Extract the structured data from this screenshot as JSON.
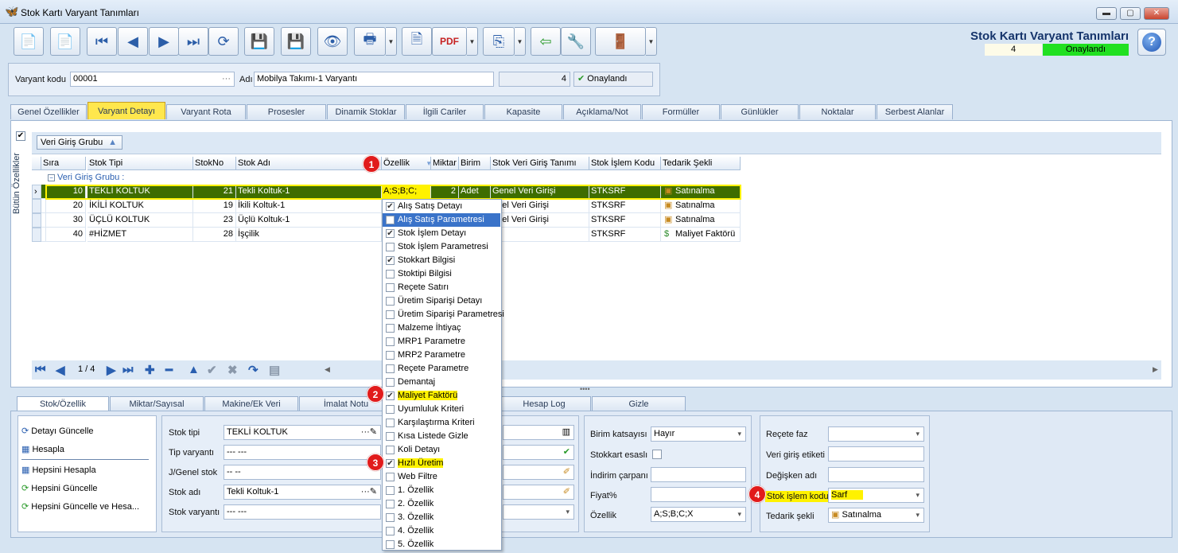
{
  "window": {
    "title": "Stok Kartı Varyant Tanımları"
  },
  "header": {
    "title": "Stok Kartı Varyant Tanımları",
    "count": "4",
    "status": "Onaylandı",
    "status_color": "#21e021"
  },
  "form": {
    "variant_code_label": "Varyant kodu",
    "variant_code": "00001",
    "name_label": "Adı",
    "name": "Mobilya Takımı-1 Varyantı",
    "count": "4",
    "approved": "Onaylandı"
  },
  "tabs": [
    "Genel Özellikler",
    "Varyant Detayı",
    "Varyant Rota",
    "Prosesler",
    "Dinamik Stoklar",
    "İlgili Cariler",
    "Kapasite",
    "Açıklama/Not",
    "Formüller",
    "Günlükler",
    "Noktalar",
    "Serbest Alanlar"
  ],
  "side_label": "Bütün Özellikler",
  "group_button": "Veri Giriş Grubu",
  "grid": {
    "columns": [
      "Sıra",
      "Stok Tipi",
      "StokNo",
      "Stok Adı",
      "Özellik",
      "Miktar",
      "Birim",
      "Stok Veri Giriş Tanımı",
      "Stok İşlem Kodu",
      "Tedarik Şekli"
    ],
    "group_label": "Veri Giriş Grubu :",
    "rows": [
      {
        "sira": "10",
        "tip": "TEKLİ KOLTUK",
        "no": "21",
        "adi": "Tekli Koltuk-1",
        "ozellik": "A;S;B;C;",
        "miktar": "2",
        "birim": "Adet",
        "veri": "Genel Veri Girişi",
        "islem": "STKSRF",
        "tedarik": "Satınalma"
      },
      {
        "sira": "20",
        "tip": "İKİLİ KOLTUK",
        "no": "19",
        "adi": "İkili Koltuk-1",
        "ozellik": "",
        "miktar": "",
        "birim": "",
        "veri": "enel Veri Girişi",
        "islem": "STKSRF",
        "tedarik": "Satınalma"
      },
      {
        "sira": "30",
        "tip": "ÜÇLÜ  KOLTUK",
        "no": "23",
        "adi": "Üçlü Koltuk-1",
        "ozellik": "",
        "miktar": "",
        "birim": "",
        "veri": "enel Veri Girişi",
        "islem": "STKSRF",
        "tedarik": "Satınalma"
      },
      {
        "sira": "40",
        "tip": "#HİZMET",
        "no": "28",
        "adi": "İşçilik",
        "ozellik": "",
        "miktar": "",
        "birim": "",
        "veri": "",
        "islem": "STKSRF",
        "tedarik": "Maliyet Faktörü"
      }
    ],
    "page": "1 / 4"
  },
  "dropdown": [
    {
      "label": "Alış Satış Detayı",
      "checked": true
    },
    {
      "label": "Alış Satış Parametresi",
      "checked": false,
      "selected": true
    },
    {
      "label": "Stok İşlem Detayı",
      "checked": true
    },
    {
      "label": "Stok İşlem Parametresi",
      "checked": false
    },
    {
      "label": "Stokkart Bilgisi",
      "checked": true
    },
    {
      "label": "Stoktipi Bilgisi",
      "checked": false
    },
    {
      "label": "Reçete Satırı",
      "checked": false
    },
    {
      "label": "Üretim Siparişi Detayı",
      "checked": false
    },
    {
      "label": "Üretim Siparişi Parametresi",
      "checked": false
    },
    {
      "label": "Malzeme İhtiyaç",
      "checked": false
    },
    {
      "label": "MRP1 Parametre",
      "checked": false
    },
    {
      "label": "MRP2 Parametre",
      "checked": false
    },
    {
      "label": "Reçete Parametre",
      "checked": false
    },
    {
      "label": "Demantaj",
      "checked": false
    },
    {
      "label": "Maliyet Faktörü",
      "checked": true,
      "highlight": true
    },
    {
      "label": "Uyumluluk Kriteri",
      "checked": false
    },
    {
      "label": "Karşılaştırma Kriteri",
      "checked": false
    },
    {
      "label": "Kısa Listede Gizle",
      "checked": false
    },
    {
      "label": "Koli Detayı",
      "checked": false
    },
    {
      "label": "Hızlı Üretim",
      "checked": true,
      "highlight": true
    },
    {
      "label": "Web Filtre",
      "checked": false
    },
    {
      "label": "1. Özellik",
      "checked": false
    },
    {
      "label": "2. Özellik",
      "checked": false
    },
    {
      "label": "3. Özellik",
      "checked": false
    },
    {
      "label": "4. Özellik",
      "checked": false
    },
    {
      "label": "5. Özellik",
      "checked": false
    }
  ],
  "bottom_tabs": [
    "Stok/Özellik",
    "Miktar/Sayısal",
    "Makine/Ek Veri",
    "İmalat Notu",
    "Hesap Log",
    "Gizle"
  ],
  "actions": [
    "Detayı Güncelle",
    "Hesapla",
    "Hepsini Hesapla",
    "Hepsini Güncelle",
    "Hepsini Güncelle ve Hesa..."
  ],
  "stock": {
    "tip_label": "Stok tipi",
    "tip": "TEKLİ KOLTUK",
    "varyant_label": "Tip varyantı",
    "varyant": "--- ---",
    "genel_label": "J/Genel stok",
    "genel": "-- --",
    "adi_label": "Stok adı",
    "adi": "Tekli Koltuk-1",
    "svar_label": "Stok varyantı",
    "svar": "--- ---"
  },
  "unit": {
    "katsayi_label": "Birim katsayısı",
    "katsayi": "Hayır",
    "esasli_label": "Stokkart esaslı",
    "indirim_label": "İndirim çarpanı",
    "fiyat_label": "Fiyat%",
    "ozellik_label": "Özellik",
    "ozellik": "A;S;B;C;X"
  },
  "recipe": {
    "faz_label": "Reçete faz",
    "etiket_label": "Veri giriş etiketi",
    "degisken_label": "Değişken adı",
    "islem_label": "Stok işlem kodu",
    "islem": "Sarf",
    "tedarik_label": "Tedarik şekli",
    "tedarik": "Satınalma"
  },
  "badges": [
    "1",
    "2",
    "3",
    "4"
  ]
}
